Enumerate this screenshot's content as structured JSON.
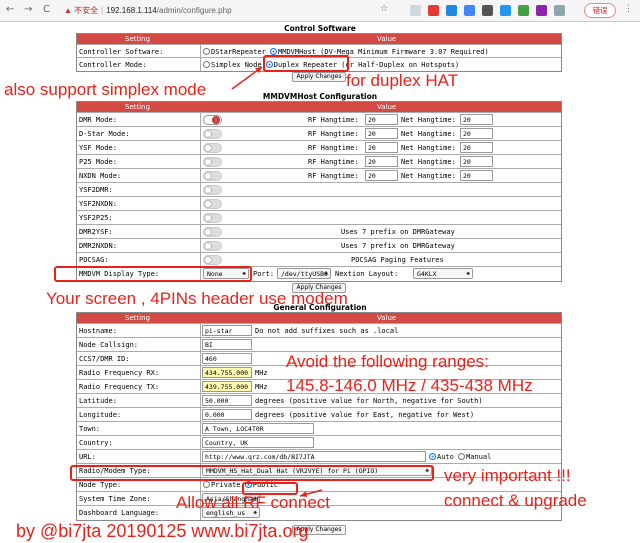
{
  "browser": {
    "back": "←",
    "forward": "→",
    "reload": "C",
    "security_label": "▲ 不安全",
    "host": "192.168.1.114",
    "path": "/admin/configure.php",
    "error_pill": "错误"
  },
  "control": {
    "title": "Control Software",
    "col_setting": "Setting",
    "col_value": "Value",
    "software_label": "Controller Software:",
    "software_opt1": "DStarRepeater",
    "software_opt2": "MMDVMHost (DV-Mega Minimum Firmware 3.07 Required)",
    "mode_label": "Controller Mode:",
    "mode_opt1": "Simplex Node",
    "mode_opt2": "Duplex Repeater",
    "mode_hint": "(or Half-Duplex on Hotspots)",
    "apply": "Apply Changes"
  },
  "mmdvm": {
    "title": "MMDVMHost Configuration",
    "col_setting": "Setting",
    "col_value": "Value",
    "rows": [
      {
        "label": "DMR Mode:",
        "rf": "RF Hangtime:",
        "rf_val": "20",
        "net": "Net Hangtime:",
        "net_val": "20"
      },
      {
        "label": "D-Star Mode:",
        "rf": "RF Hangtime:",
        "rf_val": "20",
        "net": "Net Hangtime:",
        "net_val": "20"
      },
      {
        "label": "YSF Mode:",
        "rf": "RF Hangtime:",
        "rf_val": "20",
        "net": "Net Hangtime:",
        "net_val": "20"
      },
      {
        "label": "P25 Mode:",
        "rf": "RF Hangtime:",
        "rf_val": "20",
        "net": "Net Hangtime:",
        "net_val": "20"
      },
      {
        "label": "NXDN Mode:",
        "rf": "RF Hangtime:",
        "rf_val": "20",
        "net": "Net Hangtime:",
        "net_val": "20"
      }
    ],
    "ysf2dmr": "YSF2DMR:",
    "ysf2nxdn": "YSF2NXDN:",
    "ysf2p25": "YSF2P25:",
    "dmr2ysf": "DMR2YSF:",
    "dmr2ysf_note": "Uses 7 prefix on DMRGateway",
    "dmr2nxdn": "DMR2NXDN:",
    "dmr2nxdn_note": "Uses 7 prefix on DMRGateway",
    "pocsag": "POCSAG:",
    "pocsag_note": "POCSAG Paging Features",
    "display_label": "MMDVM Display Type:",
    "display_value": "None",
    "port_label": "Port:",
    "port_value": "/dev/ttyUSB0",
    "nextion_label": "Nextion Layout:",
    "nextion_value": "G4KLX",
    "apply": "Apply Changes"
  },
  "general": {
    "title": "General Configuration",
    "col_setting": "Setting",
    "col_value": "Value",
    "hostname_label": "Hostname:",
    "hostname_value": "pi-star",
    "hostname_note": "Do not add suffixes such as .local",
    "callsign_label": "Node Callsign:",
    "callsign_value": "BI",
    "ccs7_label": "CCS7/DMR ID:",
    "ccs7_value": "460",
    "rx_label": "Radio Frequency RX:",
    "rx_value": "434.755.000",
    "rx_unit": "MHz",
    "tx_label": "Radio Frequency TX:",
    "tx_value": "439.755.000",
    "tx_unit": "MHz",
    "lat_label": "Latitude:",
    "lat_value": "50.000",
    "lat_note": "degrees (positive value for North, negative for South)",
    "lon_label": "Longitude:",
    "lon_value": "0.000",
    "lon_note": "degrees (positive value for East, negative for West)",
    "town_label": "Town:",
    "town_value": "A Town, LOC4T0R",
    "country_label": "Country:",
    "country_value": "Country, UK",
    "url_label": "URL:",
    "url_value": "http://www.qrz.com/db/BI7JTA",
    "url_auto": "Auto",
    "url_manual": "Manual",
    "modem_label": "Radio/Modem Type:",
    "modem_value": "MMDVM_HS_Hat_Dual Hat (VR2VYE) for Pi (GPIO)",
    "nodetype_label": "Node Type:",
    "nodetype_private": "Private",
    "nodetype_public": "Public",
    "tz_label": "System Time Zone:",
    "tz_value": "Asia/Shanghai",
    "lang_label": "Dashboard Language:",
    "lang_value": "english_us",
    "apply": "Apply Changes"
  },
  "annotations": {
    "simplex": "also support simplex mode",
    "duplex": "for duplex HAT",
    "screen": "Your screen , 4PINs header use modem",
    "avoid1": "Avoid the following ranges:",
    "avoid2": "145.8-146.0 MHz / 435-438 MHz",
    "important1": "very important !!!",
    "important2": "connect & upgrade",
    "allow": "Allow all RF connect",
    "credit": "by @bi7jta 20190125 www.bi7jta.org"
  },
  "colors": {
    "header_red": "#d24a43",
    "annotation_red": "#e8221b",
    "freq_highlight": "#fff9b0"
  }
}
